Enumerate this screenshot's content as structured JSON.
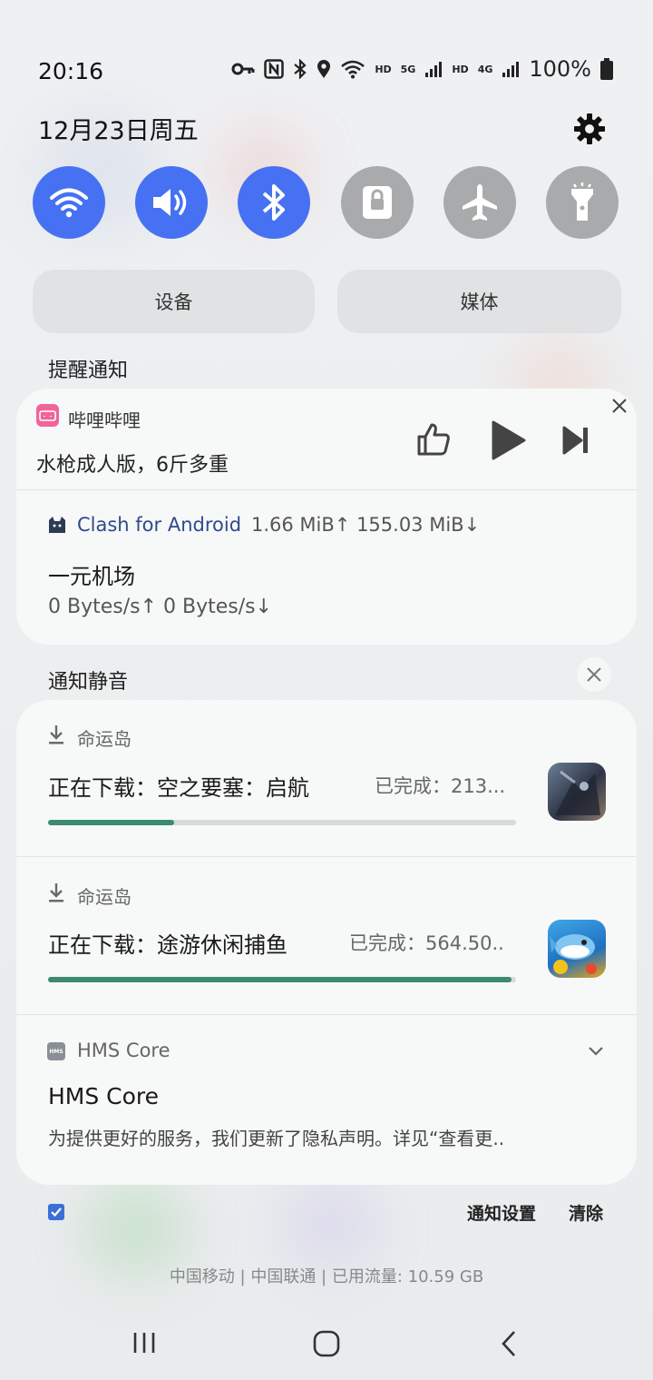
{
  "status_bar": {
    "time": "20:16",
    "battery": "100%",
    "net_hd1": "HD",
    "net_5g": "5G",
    "net_hd2": "HD",
    "net_4g": "4G"
  },
  "header": {
    "date": "12月23日周五"
  },
  "quick_settings": [
    {
      "name": "wifi",
      "icon": "wifi-icon",
      "state": "on"
    },
    {
      "name": "sound",
      "icon": "volume-icon",
      "state": "on"
    },
    {
      "name": "bluetooth",
      "icon": "bluetooth-icon",
      "state": "on"
    },
    {
      "name": "rotation-lock",
      "icon": "lock-icon",
      "state": "off"
    },
    {
      "name": "airplane",
      "icon": "airplane-icon",
      "state": "off"
    },
    {
      "name": "flashlight",
      "icon": "flashlight-icon",
      "state": "off"
    }
  ],
  "pills": {
    "devices": "设备",
    "media": "媒体"
  },
  "sections": {
    "alerting": "提醒通知",
    "silent": "通知静音"
  },
  "bilibili": {
    "app": "哔哩哔哩",
    "title": "水枪成人版，6斤多重"
  },
  "clash": {
    "app": "Clash for Android",
    "traffic": "1.66 MiB↑ 155.03 MiB↓",
    "title": "一元机场",
    "speed": "0 Bytes/s↑ 0 Bytes/s↓"
  },
  "downloads": [
    {
      "app": "命运岛",
      "title": "正在下载：空之要塞：启航",
      "status": "已完成：213...",
      "progress": 0.27
    },
    {
      "app": "命运岛",
      "title": "正在下载：途游休闲捕鱼",
      "status": "已完成：564.50..",
      "progress": 0.99
    }
  ],
  "hms": {
    "app": "HMS Core",
    "icon_text": "HMS",
    "title": "HMS Core",
    "body": "为提供更好的服务，我们更新了隐私声明。详见“查看更.."
  },
  "footer": {
    "settings": "通知设置",
    "clear": "清除",
    "carrier": "中国移动 | 中国联通 | 已用流量: 10.59 GB"
  },
  "colors": {
    "accent": "#4671f2",
    "toggle_off": "#a9aaab",
    "progress": "#3c8a72",
    "bilibili": "#f0649a"
  }
}
